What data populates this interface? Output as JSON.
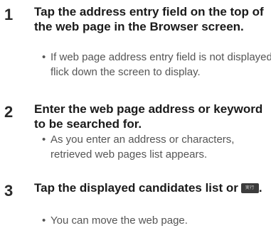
{
  "steps": [
    {
      "number": "1",
      "title": "Tap the address entry field on the top of the web page in the Browser screen.",
      "note": "If web page address entry field is not displayed, flick down the screen to display."
    },
    {
      "number": "2",
      "title": "Enter the web page address or keyword to be searched for.",
      "note": "As you enter an address or characters, retrieved web pages list appears."
    },
    {
      "number": "3",
      "title_prefix": "Tap the displayed candidates list or",
      "title_suffix": ".",
      "button_icon": "exec-button-icon",
      "button_label": "実行",
      "note": "You can move the web page."
    }
  ],
  "bullet": "•"
}
